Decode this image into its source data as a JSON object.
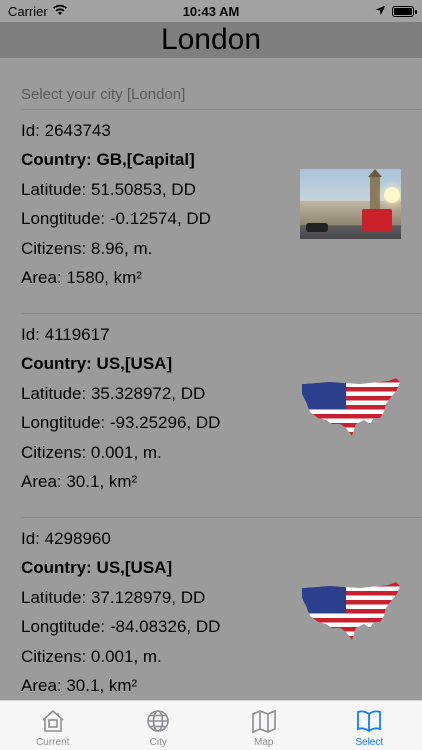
{
  "status_bar": {
    "carrier": "Carrier",
    "time": "10:43 AM",
    "battery_level": 1.0
  },
  "nav": {
    "title": "London"
  },
  "list": {
    "header": "Select your city [London]",
    "items": [
      {
        "id": "Id: 2643743",
        "country": "Country: GB,[Capital]",
        "latitude": "Latitude: 51.50853, DD",
        "longitude": "Longtitude: -0.12574, DD",
        "citizens": "Citizens: 8.96, m.",
        "area": "Area: 1580, km²",
        "image": "london-photo"
      },
      {
        "id": "Id: 4119617",
        "country": "Country: US,[USA]",
        "latitude": "Latitude: 35.328972, DD",
        "longitude": "Longtitude: -93.25296, DD",
        "citizens": "Citizens: 0.001, m.",
        "area": "Area: 30.1, km²",
        "image": "usa-flag-map"
      },
      {
        "id": "Id: 4298960",
        "country": "Country: US,[USA]",
        "latitude": "Latitude: 37.128979, DD",
        "longitude": "Longtitude: -84.08326, DD",
        "citizens": "Citizens: 0.001, m.",
        "area": "Area: 30.1, km²",
        "image": "usa-flag-map"
      }
    ]
  },
  "tabs": [
    {
      "label": "Current",
      "icon": "house-icon",
      "active": false
    },
    {
      "label": "City",
      "icon": "globe-icon",
      "active": false
    },
    {
      "label": "Map",
      "icon": "map-icon",
      "active": false
    },
    {
      "label": "Select",
      "icon": "book-icon",
      "active": true
    }
  ],
  "colors": {
    "accent": "#147efb",
    "background": "#9b9b9b",
    "nav_background": "#7f7f7f"
  }
}
